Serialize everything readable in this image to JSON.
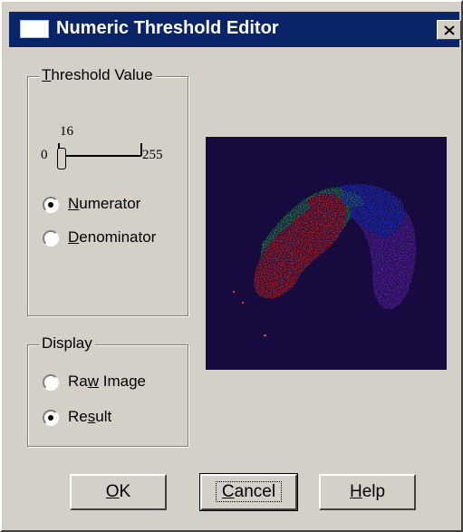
{
  "window": {
    "title": "Numeric Threshold Editor",
    "close_icon": "close-icon"
  },
  "threshold": {
    "legend_mnemonic": "T",
    "legend_rest": "hreshold Value",
    "slider": {
      "value": "16",
      "min": "0",
      "max": "255",
      "position": 16
    },
    "numerator": {
      "mnemonic": "N",
      "rest": "umerator",
      "checked": true
    },
    "denominator": {
      "mnemonic": "D",
      "rest": "enominator",
      "checked": false
    }
  },
  "display": {
    "legend": "Display",
    "raw_image": {
      "pre": "Ra",
      "mnemonic": "w",
      "post": " Image",
      "checked": false
    },
    "result": {
      "pre": "Re",
      "mnemonic": "s",
      "post": "ult",
      "checked": true
    }
  },
  "preview": {
    "background": "#160a3e",
    "colors": [
      "#ff2a10",
      "#20c040",
      "#2040ff",
      "#7a2ad0",
      "#2090e0"
    ]
  },
  "buttons": {
    "ok": {
      "mnemonic": "O",
      "rest": "K"
    },
    "cancel": {
      "mnemonic": "C",
      "rest": "ancel"
    },
    "help": {
      "mnemonic": "H",
      "rest": "elp"
    }
  }
}
